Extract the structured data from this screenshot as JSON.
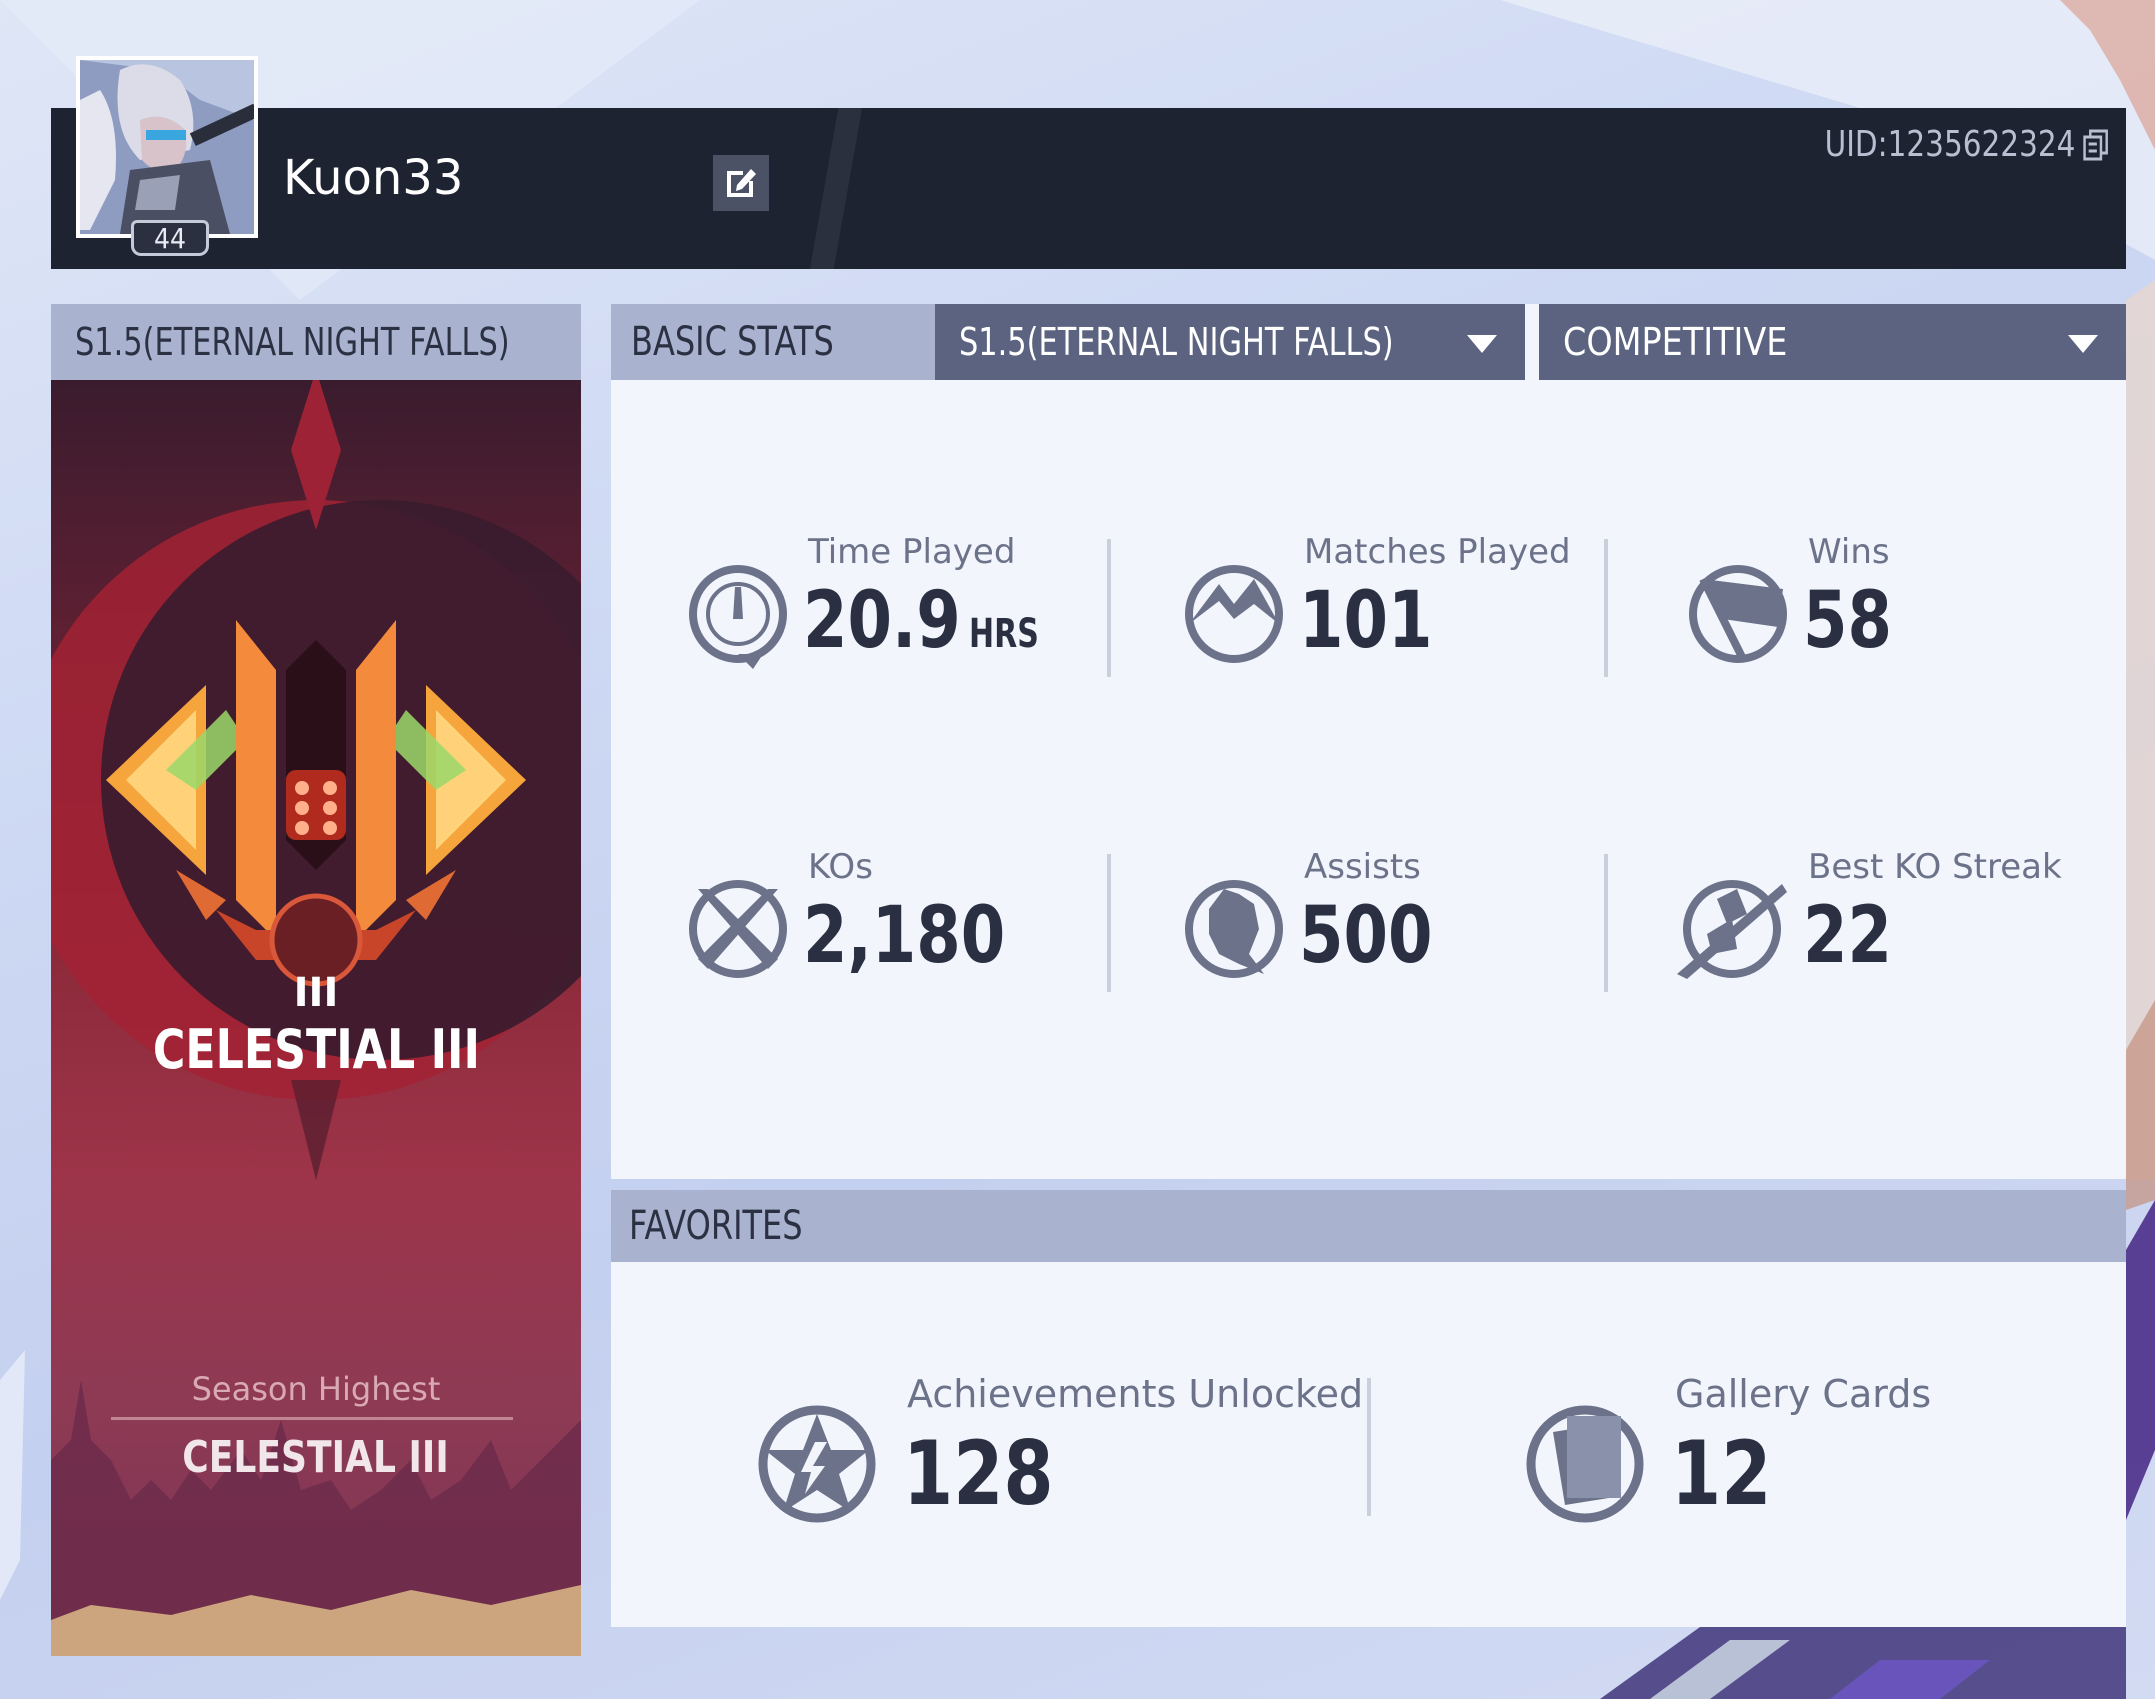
{
  "profile": {
    "username": "Kuon33",
    "level": "44",
    "uid": "UID:1235622324"
  },
  "rank_card": {
    "season_tab": "S1.5(ETERNAL NIGHT FALLS)",
    "rank_numeral": "III",
    "rank_name": "CELESTIAL III",
    "season_highest_label": "Season Highest",
    "season_highest_rank": "CELESTIAL III"
  },
  "stats": {
    "tab_label": "BASIC STATS",
    "season_dropdown": "S1.5(ETERNAL NIGHT FALLS)",
    "mode_dropdown": "COMPETITIVE",
    "items": [
      {
        "label": "Time Played",
        "value": "20.9",
        "unit": "HRS",
        "icon": "stopwatch-icon"
      },
      {
        "label": "Matches Played",
        "value": "101",
        "icon": "mountain-icon"
      },
      {
        "label": "Wins",
        "value": "58",
        "icon": "flag-icon"
      },
      {
        "label": "KOs",
        "value": "2,180",
        "icon": "crossed-swords-icon"
      },
      {
        "label": "Assists",
        "value": "500",
        "icon": "fist-icon"
      },
      {
        "label": "Best KO Streak",
        "value": "22",
        "icon": "streak-icon"
      }
    ]
  },
  "favorites": {
    "header": "FAVORITES",
    "items": [
      {
        "label": "Achievements Unlocked",
        "value": "128",
        "icon": "star-achievement-icon"
      },
      {
        "label": "Gallery Cards",
        "value": "12",
        "icon": "cards-icon"
      }
    ]
  },
  "colors": {
    "header_bg": "#1e2332",
    "tab_bg": "#a9b2ce",
    "dropdown_bg": "#5b6380",
    "panel_bg": "#f2f5fb",
    "rank_bg": "#8c2a3a",
    "rank_accent": "#f5a042",
    "text_dark": "#2a2f42",
    "text_muted": "#6b7289"
  }
}
